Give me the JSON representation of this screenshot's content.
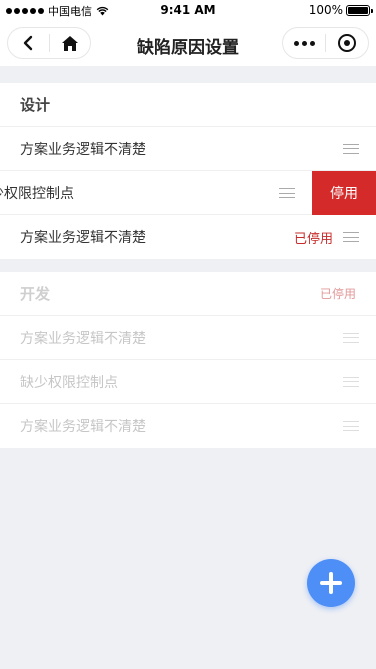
{
  "status_bar": {
    "carrier": "中国电信",
    "time": "9:41 AM",
    "battery": "100%"
  },
  "nav": {
    "title": "缺陷原因设置"
  },
  "groups": [
    {
      "title": "设计",
      "status": "",
      "items": [
        {
          "label": "方案业务逻辑不清楚",
          "status": ""
        },
        {
          "label": "缺少权限控制点",
          "visible_label": "少权限控制点",
          "action": "停用"
        },
        {
          "label": "方案业务逻辑不清楚",
          "status": "已停用"
        }
      ]
    },
    {
      "title": "开发",
      "status": "已停用",
      "items": [
        {
          "label": "方案业务逻辑不清楚"
        },
        {
          "label": "缺少权限控制点"
        },
        {
          "label": "方案业务逻辑不清楚"
        }
      ]
    }
  ],
  "icons": {
    "back": "chevron-left-icon",
    "home": "home-icon",
    "more": "more-icon",
    "close": "target-icon",
    "add": "plus-icon",
    "drag": "drag-handle-icon"
  },
  "colors": {
    "accent": "#4e8ef7",
    "danger": "#d42a2a",
    "disabled_text": "#c6c6c6",
    "background": "#eff0f4"
  }
}
